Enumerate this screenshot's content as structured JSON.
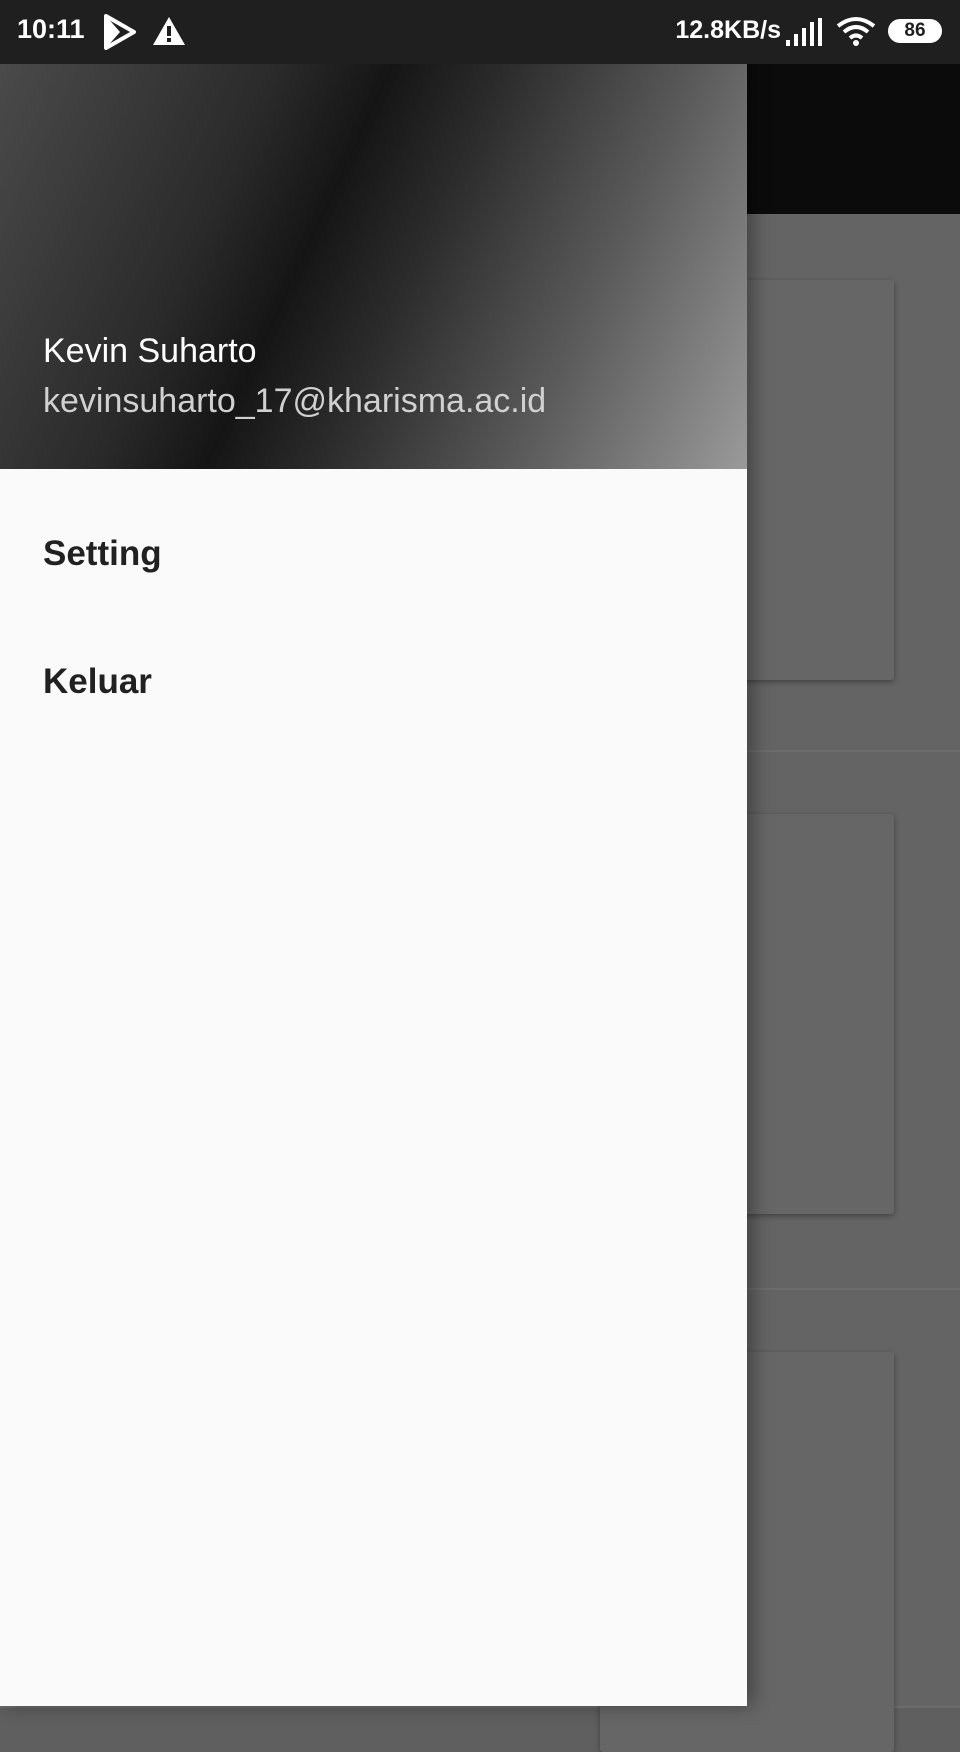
{
  "status_bar": {
    "time": "10:11",
    "network_speed": "12.8KB/s",
    "battery_level": "86",
    "icons": [
      "play-icon",
      "alert-icon",
      "signal-icon",
      "wifi-icon",
      "battery-icon"
    ]
  },
  "drawer": {
    "header": {
      "user_name": "Kevin Suharto",
      "user_email": "kevinsuharto_17@kharisma.ac.id"
    },
    "menu": [
      {
        "label": "Setting"
      },
      {
        "label": "Keluar"
      }
    ]
  },
  "colors": {
    "drawer_background": "#fafafa",
    "scrim_content": "#5f5f5f",
    "toolbar": "#0b0b0b",
    "menu_text": "#212121"
  }
}
